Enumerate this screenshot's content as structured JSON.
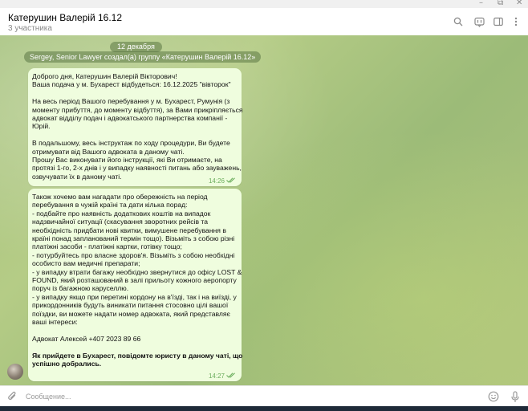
{
  "window": {
    "controls": [
      "–",
      "⧉",
      "✕"
    ]
  },
  "header": {
    "title": "Катерушин Валерій 16.12",
    "subtitle": "3 участника",
    "icons": [
      "search-icon",
      "live-stream-icon",
      "sidebar-panel-icon",
      "more-vertical-icon"
    ]
  },
  "chat": {
    "date": "12 декабря",
    "service": "Sergey, Senior Lawyer создал(а) группу «Катерушин Валерій 16.12»",
    "messages": [
      {
        "lines": [
          "Доброго дня, Катерушин Валерій Вікторович!",
          "Ваша подача у м. Бухарест відбудеться: 16.12.2025 \"вівторок\"",
          "",
          "На весь період Вашого перебування у м. Бухарест, Румунія (з",
          "моменту прибуття, до моменту відбуття), за Вами прикріпляється",
          "адвокат відділу подач і адвокатського партнерства компанії -",
          "Юрій.",
          "",
          "В подальшому, весь інструктаж по ходу процедури, Ви будете",
          "отримувати від Вашого адвоката в даному чаті.",
          "Прошу Вас виконувати його інструкції, які Ви отримаєте, на",
          "протязі 1-го, 2-х днів і у випадку наявності питань або зауважень,",
          "озвучувати їх в даному чаті."
        ],
        "time": "14:26",
        "status": "read"
      },
      {
        "lines": [
          "Також хочемо вам нагадати про обережність на період",
          "перебування в чужій країні та дати кілька порад:",
          "- подбайте про наявність додаткових коштів на випадок",
          "надзвичайної ситуації (скасування зворотних рейсів та",
          "необхідність придбати нові квитки, вимушене перебування в",
          "країні понад запланований термін тощо). Візьміть з собою різні",
          "платіжні засоби - платіжні картки, готівку тощо;",
          "- потурбуйтесь про власне здоров'я. Візьміть з собою необхідні",
          "особисто вам медичні препарати;",
          "- у випадку втрати багажу необхідно звернутися до офісу LOST &",
          "FOUND, який розташований в залі прильоту кожного аеропорту",
          "поруч із багажною каруселлю.",
          "- у випадку якщо при перетині кордону на в'їзді, так і на виїзді, у",
          "прикордонників будуть виникати питання стосовно цілі вашої",
          "поїздки, ви можете надати номер адвоката, який представляє",
          "ваші інтереси:",
          "",
          "Адвокат Алексей +407 2023 89 66",
          "",
          "Як прийдете в Бухарест, повідомте юристу в даному чаті, що",
          "успішно добрались."
        ],
        "bold_from": 19,
        "time": "14:27",
        "status": "read"
      }
    ]
  },
  "composer": {
    "placeholder": "Сообщение...",
    "icons": [
      "attach-icon",
      "emoji-icon",
      "microphone-icon"
    ]
  }
}
